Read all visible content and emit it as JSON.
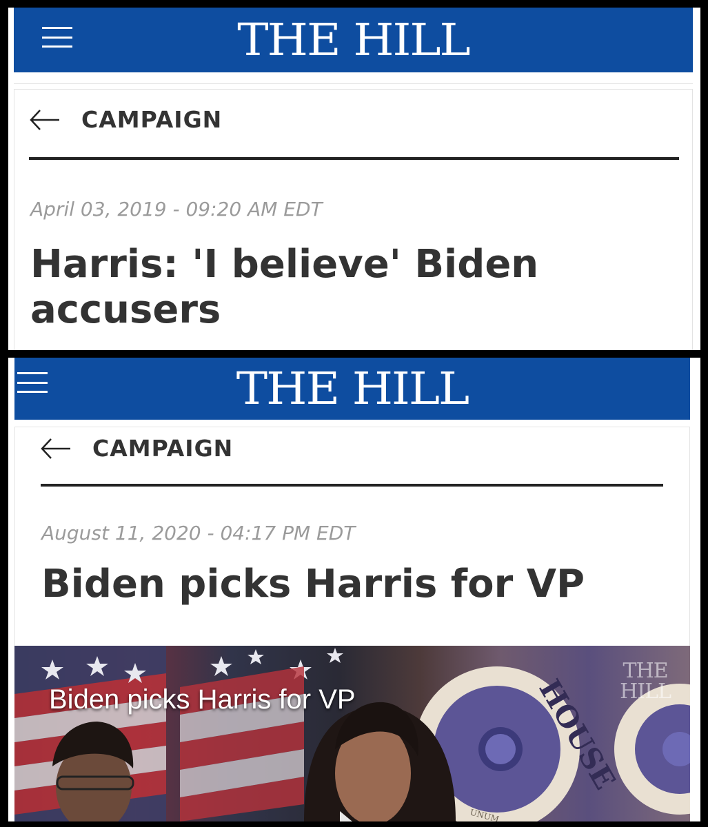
{
  "screenshots": [
    {
      "site_logo": "THE HILL",
      "menu_icon": "hamburger-menu-icon",
      "back_icon": "back-arrow-icon",
      "section": "CAMPAIGN",
      "date": "April 03, 2019 - 09:20 AM EDT",
      "headline": "Harris: 'I believe' Biden accusers"
    },
    {
      "site_logo": "THE HILL",
      "menu_icon": "hamburger-menu-icon",
      "back_icon": "back-arrow-icon",
      "section": "CAMPAIGN",
      "date": "August 11, 2020 - 04:17 PM EDT",
      "headline": "Biden picks Harris for VP",
      "video": {
        "caption": "Biden picks Harris for VP",
        "watermark_line1": "THE",
        "watermark_line2": "HILL",
        "seal_text": "HOUSE",
        "seal_text_2": "UNUM"
      }
    }
  ],
  "colors": {
    "masthead_blue": "#0e4da0",
    "text_dark": "#333333",
    "date_gray": "#9b9b9b",
    "frame_black": "#000000"
  }
}
